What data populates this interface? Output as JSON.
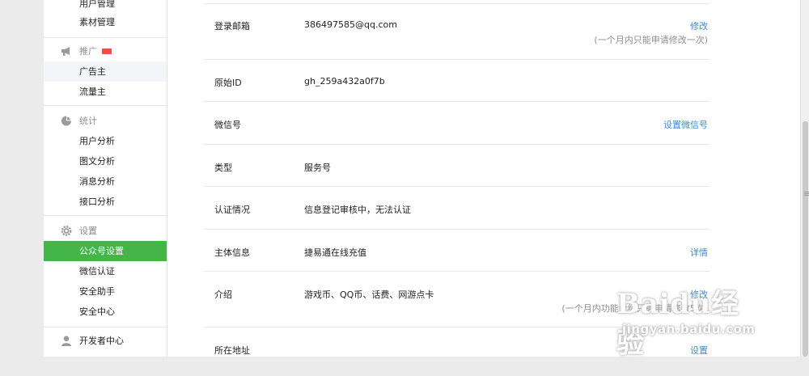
{
  "sidebar": {
    "items_top": [
      {
        "label": "用户管理"
      },
      {
        "label": "素材管理"
      }
    ],
    "promotion": {
      "title": "推广",
      "badge": "new",
      "items": [
        {
          "label": "广告主"
        },
        {
          "label": "流量主"
        }
      ]
    },
    "stats": {
      "title": "统计",
      "items": [
        {
          "label": "用户分析"
        },
        {
          "label": "图文分析"
        },
        {
          "label": "消息分析"
        },
        {
          "label": "接口分析"
        }
      ]
    },
    "settings": {
      "title": "设置",
      "items": [
        {
          "label": "公众号设置"
        },
        {
          "label": "微信认证"
        },
        {
          "label": "安全助手"
        },
        {
          "label": "安全中心"
        }
      ]
    },
    "developer": {
      "title": "开发者中心"
    }
  },
  "account": {
    "email": {
      "label": "登录邮箱",
      "value": "386497585@qq.com",
      "action": "修改",
      "note": "(一个月内只能申请修改一次)"
    },
    "original_id": {
      "label": "原始ID",
      "value": "gh_259a432a0f7b"
    },
    "wechat_id": {
      "label": "微信号",
      "action": "设置微信号"
    },
    "type": {
      "label": "类型",
      "value": "服务号"
    },
    "verification": {
      "label": "认证情况",
      "value": "信息登记审核中，无法认证"
    },
    "entity": {
      "label": "主体信息",
      "value": "捷易通在线充值",
      "action": "详情"
    },
    "intro": {
      "label": "介绍",
      "value": "游戏币、QQ币、话费、网游点卡",
      "action": "修改",
      "note": "(一个月内功能介绍只能申请修改5次)"
    },
    "address": {
      "label": "所在地址",
      "action": "设置"
    }
  },
  "watermark": {
    "logo": "Baidu经验",
    "url": "jingyan.baidu.com"
  },
  "colors": {
    "accent_green": "#44b549",
    "link_blue": "#3b8ad6",
    "muted": "#8d8d8d"
  }
}
